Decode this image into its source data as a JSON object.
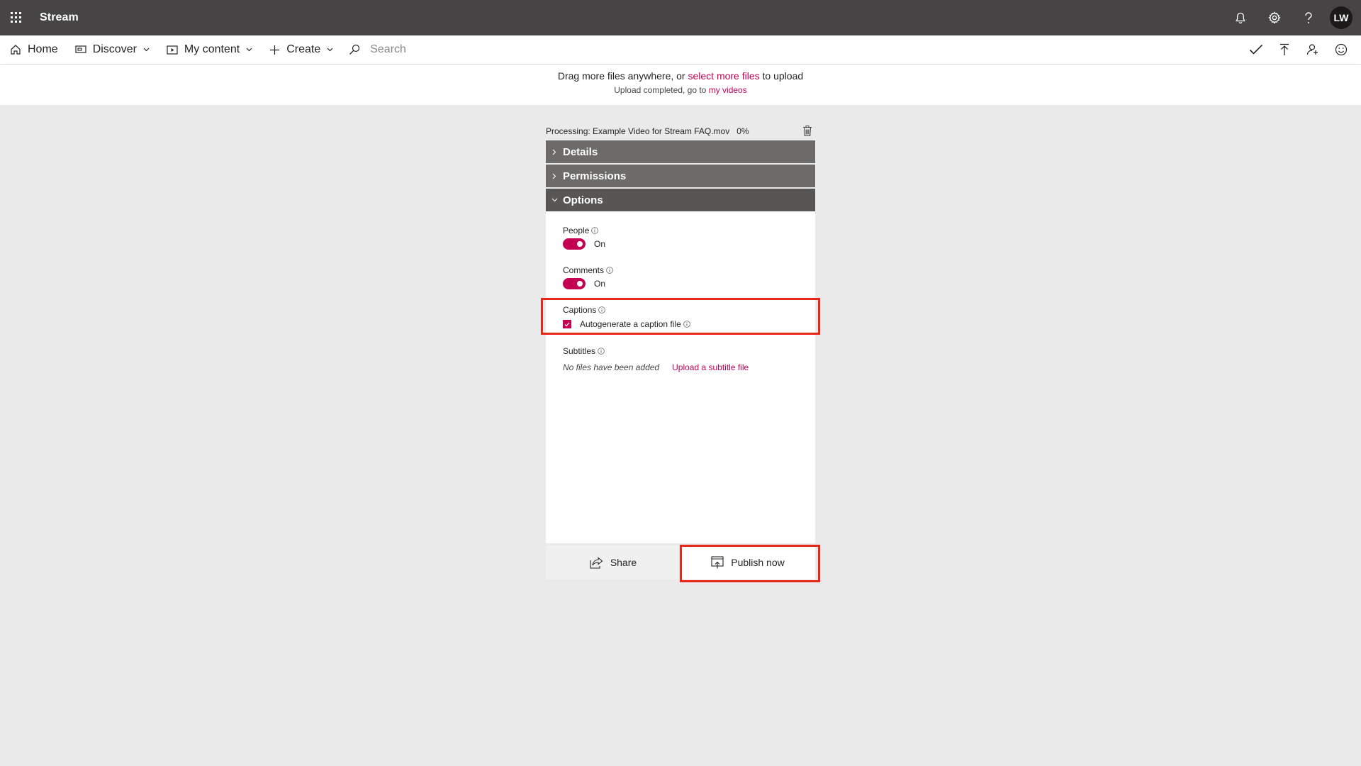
{
  "app": {
    "title": "Stream",
    "avatar_initials": "LW"
  },
  "nav": {
    "home": "Home",
    "discover": "Discover",
    "my_content": "My content",
    "create": "Create",
    "search_placeholder": "Search"
  },
  "banner": {
    "line1_prefix": "Drag more files anywhere, or",
    "line1_link": "select more files",
    "line1_suffix": "to upload",
    "line2_prefix": "Upload completed, go to",
    "line2_link": "my videos"
  },
  "upload": {
    "processing_text": "Processing: Example Video for Stream FAQ.mov",
    "percent": "0%",
    "sections": {
      "details": "Details",
      "permissions": "Permissions",
      "options": "Options"
    },
    "options": {
      "people_label": "People",
      "people_state": "On",
      "comments_label": "Comments",
      "comments_state": "On",
      "captions_label": "Captions",
      "autogenerate_label": "Autogenerate a caption file",
      "subtitles_label": "Subtitles",
      "no_files": "No files have been added",
      "upload_subtitle": "Upload a subtitle file"
    },
    "footer": {
      "share": "Share",
      "publish": "Publish now"
    }
  },
  "colors": {
    "accent": "#c30052",
    "suitebar": "#464444",
    "highlight": "#e8261a"
  },
  "icons": [
    "waffle-icon",
    "bell-icon",
    "gear-icon",
    "help-icon",
    "home-icon",
    "discover-icon",
    "my-content-icon",
    "plus-icon",
    "chevron-down-icon",
    "search-icon",
    "check-icon",
    "upload-icon",
    "add-person-icon",
    "smiley-icon",
    "trash-icon",
    "info-icon",
    "share-icon",
    "publish-icon"
  ]
}
